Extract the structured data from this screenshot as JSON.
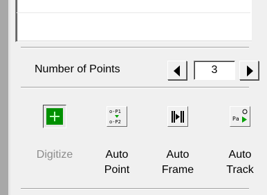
{
  "number_of_points": {
    "label": "Number of Points",
    "value": "3"
  },
  "tools": [
    {
      "label": "Digitize",
      "icon": "digitize-icon",
      "enabled": false
    },
    {
      "label": "Auto\nPoint",
      "icon": "auto-point-icon",
      "enabled": true
    },
    {
      "label": "Auto\nFrame",
      "icon": "auto-frame-icon",
      "enabled": true
    },
    {
      "label": "Auto\nTrack",
      "icon": "auto-track-icon",
      "enabled": true
    }
  ],
  "icon_text": {
    "auto_point_p1": "o-P1",
    "auto_point_p2": "o-P2",
    "auto_track_p": "Pa"
  },
  "colors": {
    "digitize_green": "#009000",
    "auto_track_green": "#00a000"
  }
}
